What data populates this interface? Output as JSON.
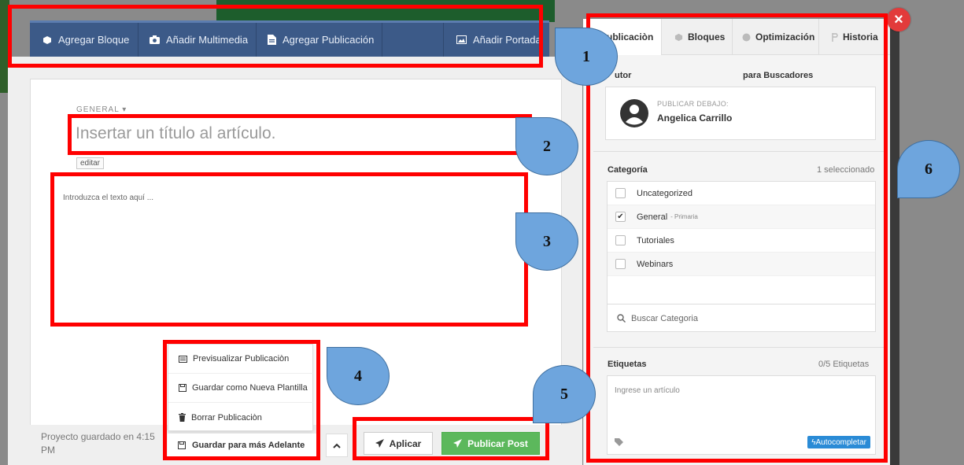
{
  "toolbar": {
    "add_block": "Agregar Bloque",
    "add_media": "Añadir Multimedia",
    "add_publication": "Agregar Publicación",
    "add_cover": "Añadir Portada"
  },
  "editor": {
    "category_label": "GENERAL ▾",
    "title_placeholder": "Insertar un título al artículo.",
    "edit_label": "editar",
    "body_placeholder": "Introduzca el texto aquí ..."
  },
  "footer": {
    "saved_text": "Proyecto guardado en 4:15 PM",
    "menu": {
      "preview": "Previsualizar Publicaciòn",
      "save_template": "Guardar como Nueva Plantilla",
      "delete": "Borrar Publicaciòn"
    },
    "save_later": "Guardar para más Adelante",
    "apply": "Aplicar",
    "publish": "Publicar Post"
  },
  "sidebar": {
    "tabs": [
      "ublicaciòn",
      "Bloques",
      "Optimización",
      "Historia"
    ],
    "author_col": "utor",
    "seo_col": "para Buscadores",
    "publish_under": "PUBLICAR DEBAJO:",
    "author_name": "Angelica Carrillo",
    "category_title": "Categoría",
    "category_count": "1 seleccionado",
    "categories": [
      {
        "name": "Uncategorized",
        "checked": false,
        "tag": ""
      },
      {
        "name": "General",
        "checked": true,
        "tag": "- Primaria"
      },
      {
        "name": "Tutoriales",
        "checked": false,
        "tag": ""
      },
      {
        "name": "Webinars",
        "checked": false,
        "tag": ""
      }
    ],
    "search_category": "Buscar Categoria",
    "tags_title": "Etiquetas",
    "tags_count": "0/5 Etiquetas",
    "tags_placeholder": "Ingrese un artículo",
    "autocomplete": "Autocompletar"
  },
  "callouts": [
    "1",
    "2",
    "3",
    "4",
    "5",
    "6"
  ],
  "colors": {
    "annotation_red": "#ff0000",
    "callout_blue": "#6ea5dd",
    "toolbar_blue": "#3c5a88",
    "publish_green": "#5cb85c"
  }
}
